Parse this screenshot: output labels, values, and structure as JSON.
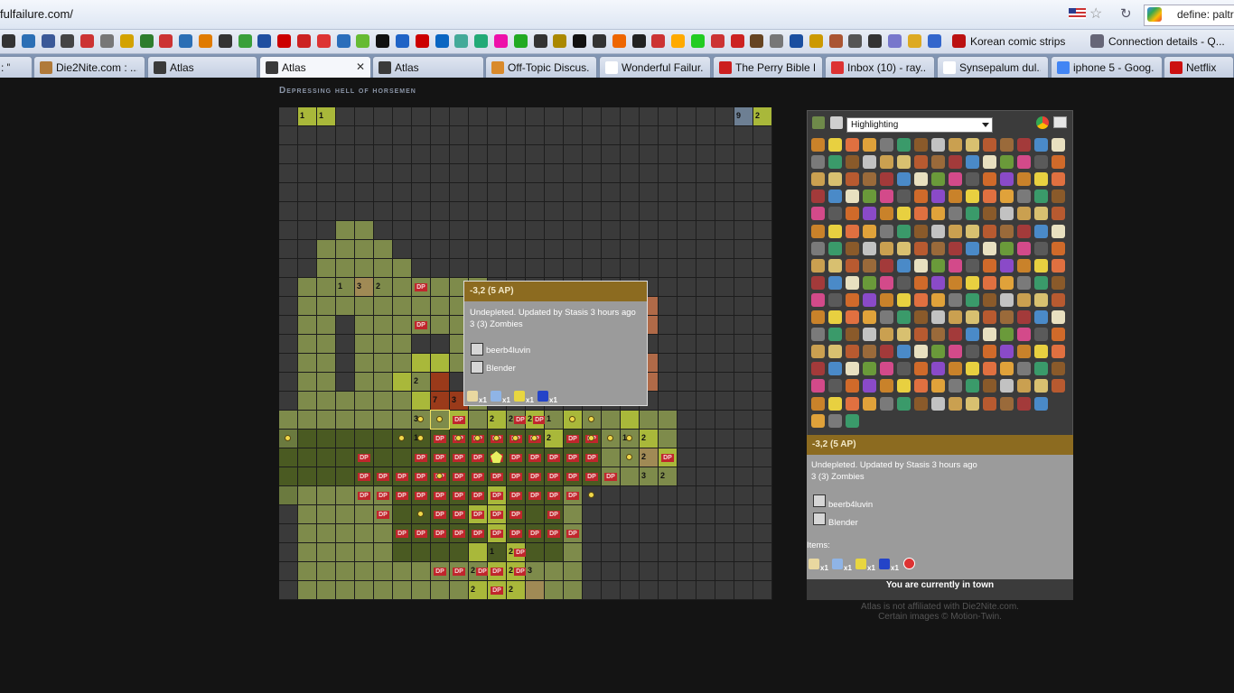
{
  "browser": {
    "url": "fulfailure.com/",
    "search_text": "define: paltr",
    "bookmarks": [
      {
        "label": "Korean comic strips",
        "icon": "folder-icon"
      },
      {
        "label": "Connection details - Q...",
        "icon": "page-icon"
      }
    ],
    "tabs": [
      {
        "title": ": \"...",
        "color": "#6a6a6a"
      },
      {
        "title": "Die2Nite.com : ...",
        "color": "#b07a3a"
      },
      {
        "title": "Atlas",
        "color": "#3a3a3a"
      },
      {
        "title": "Atlas",
        "color": "#3a3a3a",
        "active": true,
        "close": "✕"
      },
      {
        "title": "Atlas",
        "color": "#3a3a3a"
      },
      {
        "title": "Off-Topic Discus...",
        "color": "#d98a2b"
      },
      {
        "title": "Wonderful Failur...",
        "color": "#ffffff"
      },
      {
        "title": "The Perry Bible F...",
        "color": "#cc1f1f"
      },
      {
        "title": "Inbox (10) - ray...",
        "color": "#d33"
      },
      {
        "title": "Synsepalum dul...",
        "color": "#ffffff"
      },
      {
        "title": "iphone 5 - Goog...",
        "color": "#4285f4"
      },
      {
        "title": "Netflix",
        "color": "#c11"
      }
    ]
  },
  "page": {
    "town_name": "Depressing hell of horsemen",
    "highlight_select": "Highlighting",
    "tooltip": {
      "coords": "-3,2 (5 AP)",
      "status": "Undepleted. Updated by Stasis 3 hours ago",
      "zombies": "3 (3) Zombies",
      "users": [
        "beerb4luvin",
        "Blender"
      ],
      "items": [
        {
          "icon": "bone-icon",
          "qty": "x1"
        },
        {
          "icon": "syringe-icon",
          "qty": "x1"
        },
        {
          "icon": "battery-icon",
          "qty": "x1"
        },
        {
          "icon": "pill-icon",
          "qty": "x1"
        }
      ]
    },
    "info_panel": {
      "coords": "-3,2 (5 AP)",
      "status": "Undepleted. Updated by Stasis 3 hours ago",
      "zombies": "3 (3) Zombies",
      "users": [
        "beerb4luvin",
        "Blender"
      ],
      "items_label": "Items:",
      "items_qty": [
        "x1",
        "x1",
        "x1",
        "x1"
      ],
      "town_status": "You are currently in town"
    },
    "disclaimer_1": "Atlas is not affiliated with Die2Nite.com.",
    "disclaimer_2": "Certain images © Motion-Twin.",
    "dp_label": "DP",
    "colors": {
      "dark": "#3a3a3a",
      "olive": "#6b7a3f",
      "explored": "#7e8b4b",
      "bright": "#a9b83a",
      "green_dark": "#4a5a22",
      "tan": "#a08a55",
      "red": "#9a3a1a",
      "salmon": "#b06a48",
      "blue_gray": "#6d7f93"
    }
  }
}
